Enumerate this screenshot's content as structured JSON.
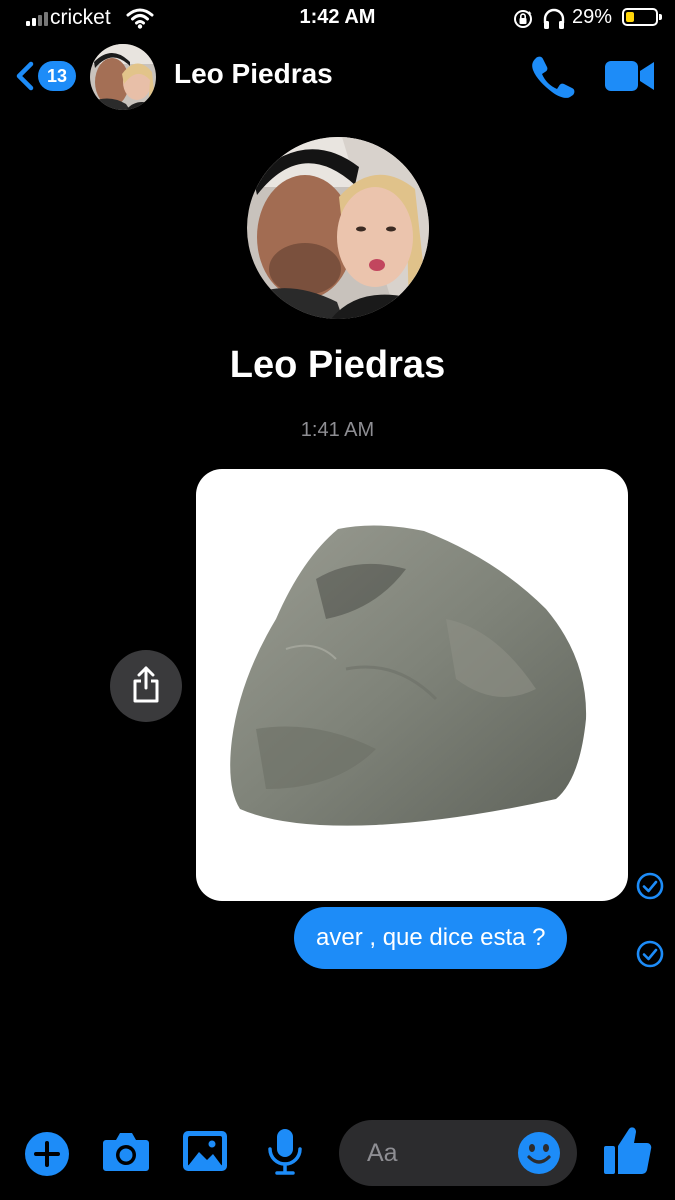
{
  "status_bar": {
    "carrier": "cricket",
    "time": "1:42 AM",
    "battery_percent": "29%",
    "battery_level": 0.29,
    "battery_color": "#ffd60a"
  },
  "header": {
    "back_count": "13",
    "contact_name": "Leo Piedras",
    "icons": [
      "back-chevron-icon",
      "phone-icon",
      "video-camera-icon"
    ]
  },
  "profile": {
    "name": "Leo Piedras"
  },
  "conversation": {
    "timestamp": "1:41 AM",
    "messages": [
      {
        "type": "image",
        "subject": "rock",
        "status": "sent"
      },
      {
        "type": "text",
        "text": "aver , que dice esta ?",
        "status": "sent"
      }
    ]
  },
  "composer": {
    "placeholder": "Aa",
    "icons": [
      "plus-icon",
      "camera-icon",
      "gallery-icon",
      "microphone-icon",
      "emoji-icon",
      "thumbs-up-icon"
    ]
  },
  "colors": {
    "accent": "#1d8cf8",
    "background": "#000000",
    "composer_bg": "#2c2c2e",
    "muted_text": "#8e8e93"
  }
}
